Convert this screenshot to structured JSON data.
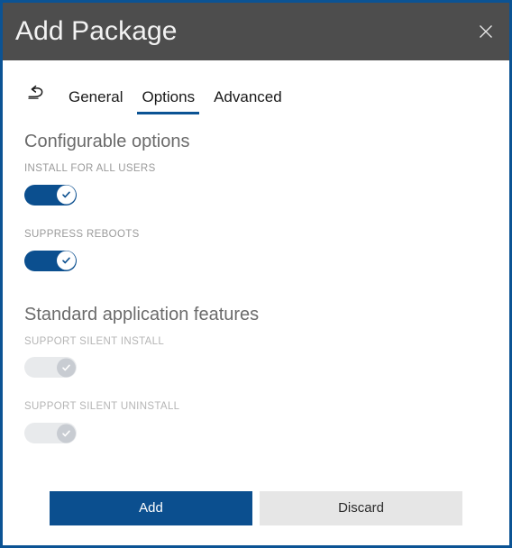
{
  "window": {
    "title": "Add Package",
    "close_label": "×",
    "border_color": "#0b5394",
    "titlebar_color": "#4d4d4d"
  },
  "nav": {
    "back_icon": "undo-arrow-icon",
    "tabs": [
      {
        "label": "General",
        "active": false
      },
      {
        "label": "Options",
        "active": true
      },
      {
        "label": "Advanced",
        "active": false
      }
    ]
  },
  "sections": [
    {
      "heading": "Configurable options",
      "options": [
        {
          "label": "INSTALL FOR ALL USERS",
          "state": "on",
          "enabled": true
        },
        {
          "label": "SUPPRESS REBOOTS",
          "state": "on",
          "enabled": true
        }
      ]
    },
    {
      "heading": "Standard application features",
      "options": [
        {
          "label": "SUPPORT SILENT INSTALL",
          "state": "off",
          "enabled": false
        },
        {
          "label": "SUPPORT SILENT UNINSTALL",
          "state": "off",
          "enabled": false
        }
      ]
    }
  ],
  "footer": {
    "add_label": "Add",
    "discard_label": "Discard"
  },
  "colors": {
    "accent_blue": "#0b4f8f",
    "toggle_on": "#0b4f8f",
    "toggle_off": "#e8eaec",
    "toggle_off_knob": "#c8ccd2",
    "discard_bg": "#e6e6e6",
    "label_gray": "#9a9a9a",
    "heading_gray": "#6b6b6b"
  }
}
